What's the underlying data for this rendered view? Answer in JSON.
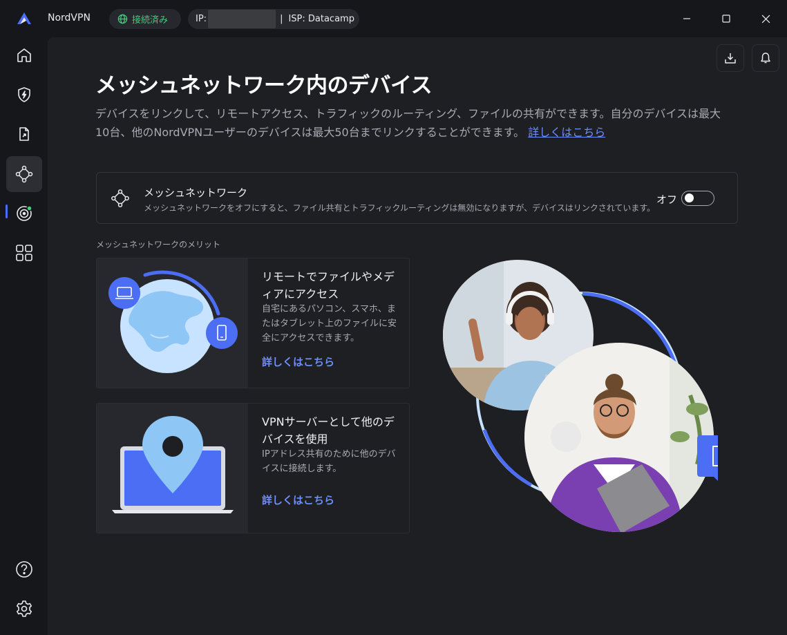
{
  "titlebar": {
    "app_name": "NordVPN",
    "status": "接続済み",
    "ip_label": "IP:",
    "separator": "|",
    "isp": "ISP: Datacamp"
  },
  "sidebar": {
    "items": [
      {
        "name": "home",
        "icon": "home-icon"
      },
      {
        "name": "threat-protection",
        "icon": "shield-bolt-icon"
      },
      {
        "name": "file-share",
        "icon": "file-share-icon"
      },
      {
        "name": "meshnet",
        "icon": "meshnet-icon",
        "active": true
      },
      {
        "name": "dark-web-monitor",
        "icon": "target-icon"
      },
      {
        "name": "apps",
        "icon": "apps-grid-icon"
      },
      {
        "name": "help",
        "icon": "help-icon"
      },
      {
        "name": "settings",
        "icon": "gear-icon"
      }
    ]
  },
  "page": {
    "title": "メッシュネットワーク内のデバイス",
    "description": "デバイスをリンクして、リモートアクセス、トラフィックのルーティング、ファイルの共有ができます。自分のデバイスは最大10台、他のNordVPNユーザーのデバイスは最大50台までリンクすることができます。",
    "learn_more": "詳しくはこちら"
  },
  "meshnet_card": {
    "title": "メッシュネットワーク",
    "subtitle": "メッシュネットワークをオフにすると、ファイル共有とトラフィックルーティングは無効になりますが、デバイスはリンクされています。",
    "toggle_label": "オフ",
    "toggle_on": false
  },
  "benefits": {
    "section_label": "メッシュネットワークのメリット",
    "items": [
      {
        "title": "リモートでファイルやメディアにアクセス",
        "description": "自宅にあるパソコン、スマホ、またはタブレット上のファイルに安全にアクセスできます。",
        "link": "詳しくはこちら"
      },
      {
        "title": "VPNサーバーとして他のデバイスを使用",
        "description": "IPアドレス共有のために他のデバイスに接続します。",
        "link": "詳しくはこちら"
      }
    ]
  },
  "colors": {
    "accent": "#4c6ef5",
    "link": "#6e8dfb",
    "connected": "#3fcf7c",
    "background": "#1e1f23"
  }
}
